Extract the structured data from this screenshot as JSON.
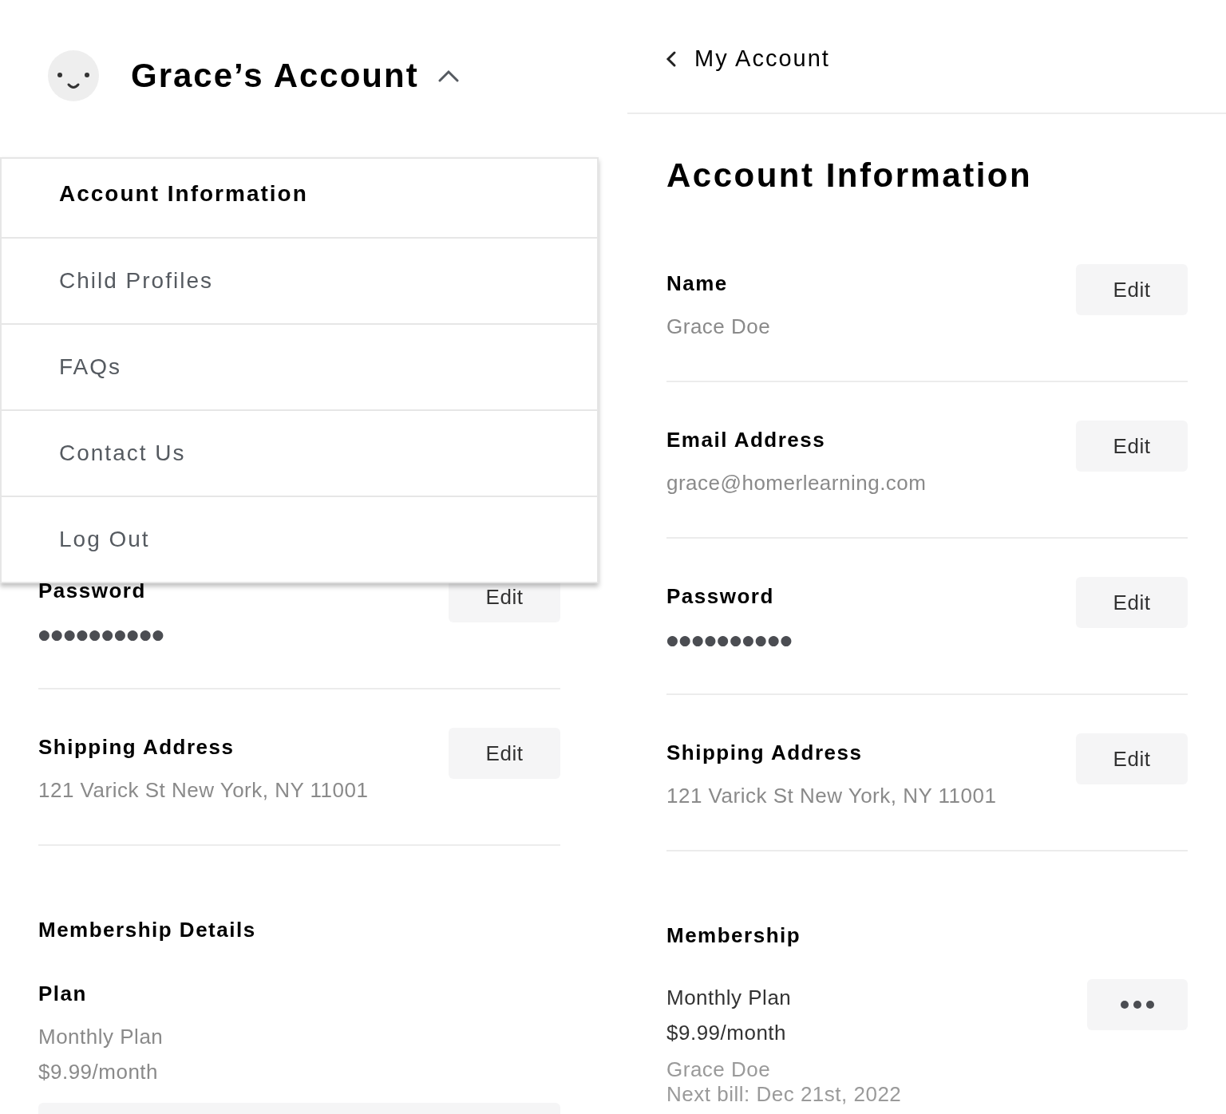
{
  "header": {
    "title": "Grace’s Account",
    "expanded": true
  },
  "menu": [
    {
      "label": "Account Information",
      "selected": true
    },
    {
      "label": "Child Profiles",
      "selected": false
    },
    {
      "label": "FAQs",
      "selected": false
    },
    {
      "label": "Contact Us",
      "selected": false
    },
    {
      "label": "Log Out",
      "selected": false
    }
  ],
  "left_page": {
    "sections": [
      {
        "label": "Password",
        "kind": "password",
        "value": "●●●●●●●●●●",
        "button": "Edit"
      },
      {
        "label": "Shipping Address",
        "kind": "text",
        "value": "121 Varick St New York, NY 11001",
        "button": "Edit"
      }
    ],
    "membership": {
      "title": "Membership Details",
      "plan_label": "Plan",
      "plan": "Monthly Plan",
      "price": "$9.99/month"
    }
  },
  "right_page": {
    "back": "My Account",
    "title": "Account Information",
    "sections": [
      {
        "label": "Name",
        "kind": "text",
        "value": "Grace Doe",
        "button": "Edit"
      },
      {
        "label": "Email Address",
        "kind": "text",
        "value": "grace@homerlearning.com",
        "button": "Edit"
      },
      {
        "label": "Password",
        "kind": "password",
        "value": "●●●●●●●●●●",
        "button": "Edit"
      },
      {
        "label": "Shipping Address",
        "kind": "text",
        "value": "121 Varick St New York, NY 11001",
        "button": "Edit"
      }
    ],
    "membership": {
      "title": "Membership",
      "plan": "Monthly Plan",
      "price": "$9.99/month",
      "holder": "Grace Doe",
      "next_bill": "Next bill: Dec 21st, 2022"
    }
  }
}
